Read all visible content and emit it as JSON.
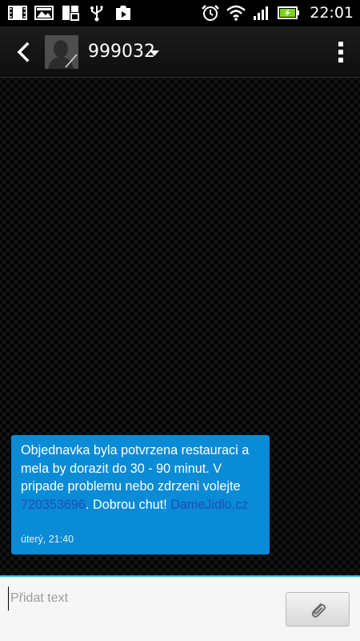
{
  "status_bar": {
    "time": "22:01",
    "left_icons": [
      "film-icon",
      "gallery-icon",
      "widgets-icon",
      "usb-icon",
      "play-store-icon"
    ],
    "right_icons": [
      "alarm-icon",
      "wifi-icon",
      "signal-icon",
      "battery-charging-icon"
    ],
    "battery_color": "#7ed321"
  },
  "header": {
    "contact_name": "999032",
    "icons": [
      "back-icon",
      "avatar-placeholder",
      "chevron-down-icon",
      "overflow-menu-icon"
    ]
  },
  "messages": [
    {
      "text_before_phone": "Objednavka byla potvrzena restauraci a mela by dorazit do 30 - 90 minut. V pripade problemu nebo zdrzeni volejte ",
      "phone_link": "720353696",
      "text_after_phone": ". Dobrou chut! ",
      "web_link": "DameJidlo.cz",
      "timestamp": "úterý, 21:40"
    }
  ],
  "compose": {
    "placeholder": "Přidat text",
    "attach_icon": "paperclip-icon"
  },
  "colors": {
    "bubble": "#0a8bd6",
    "link": "#1e4fb8",
    "compose_border": "#3ab3e8"
  }
}
